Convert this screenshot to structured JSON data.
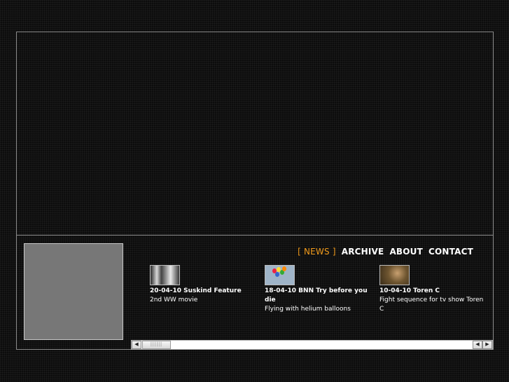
{
  "nav": {
    "items": [
      "[ NEWS ]",
      "ARCHIVE",
      "ABOUT",
      "CONTACT"
    ],
    "active_color": "#f39c1c"
  },
  "news": [
    {
      "title": "20-04-10 Suskind Feature",
      "desc": "2nd WW movie",
      "thumb": "black-and-white-film-still"
    },
    {
      "title": "18-04-10 BNN Try before you die",
      "desc": "Flying with helium balloons",
      "thumb": "balloons-sky"
    },
    {
      "title": "10-04-10 Toren C",
      "desc": "Fight sequence for tv show Toren C",
      "thumb": "fight-scene"
    }
  ],
  "scrollbar": {
    "left_arrow": "◀",
    "right_arrow_1": "◀",
    "right_arrow_2": "▶",
    "thumb_grip": "||||||"
  }
}
